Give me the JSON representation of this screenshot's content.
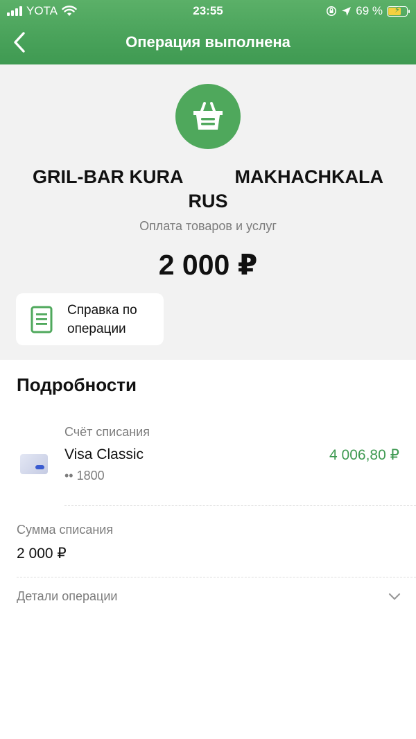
{
  "status_bar": {
    "carrier": "YOTA",
    "time": "23:55",
    "battery": "69 %",
    "battery_level": 0.69
  },
  "nav": {
    "title": "Операция выполнена",
    "back_icon": "chevron-left-icon"
  },
  "summary": {
    "category_icon": "shopping-basket-icon",
    "merchant": "GRIL-BAR KURA          MAKHACHKALA\nRUS",
    "category": "Оплата товаров и услуг",
    "amount": "2 000 ₽",
    "receipt_button": {
      "icon": "document-icon",
      "label": "Справка по операции"
    }
  },
  "details": {
    "title": "Подробности",
    "account": {
      "label": "Счёт списания",
      "name": "Visa Classic",
      "number": "•• 1800",
      "balance": "4 006,80 ₽",
      "icon": "card-icon"
    },
    "debit": {
      "label": "Сумма списания",
      "value": "2 000 ₽"
    },
    "operation_details": {
      "label": "Детали операции",
      "icon": "chevron-down-icon"
    }
  },
  "colors": {
    "brand_green": "#4aa35b",
    "balance_green": "#3f9a52",
    "background_gray": "#f2f2f2",
    "secondary_text": "#7c7c7c"
  }
}
